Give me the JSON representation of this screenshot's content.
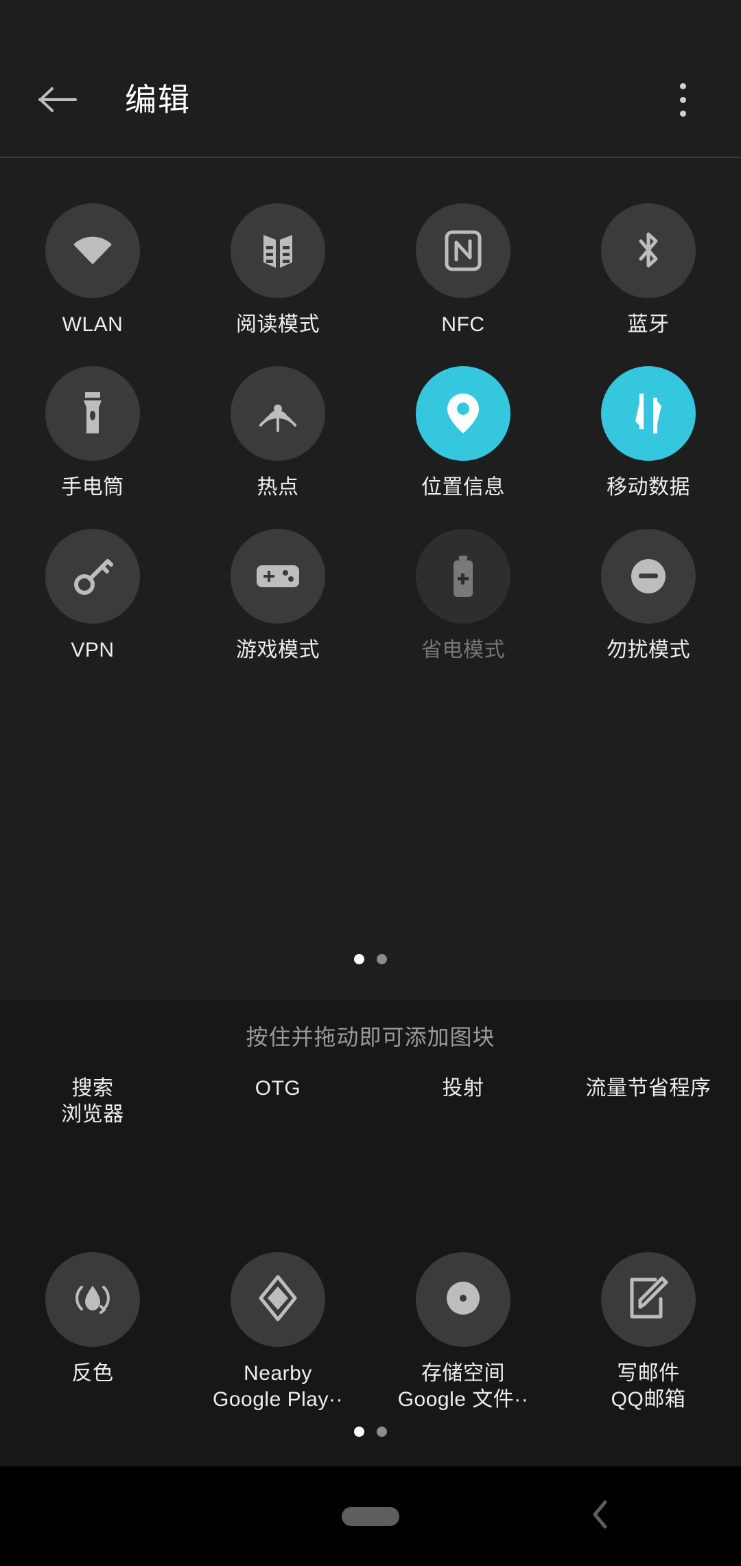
{
  "app_bar": {
    "title": "编辑",
    "back_icon": "arrow-left-icon",
    "overflow_icon": "more-vertical-icon"
  },
  "active_tiles": {
    "rows": [
      [
        {
          "label": "WLAN",
          "icon": "wifi-icon",
          "state": "off"
        },
        {
          "label": "阅读模式",
          "icon": "book-icon",
          "state": "off"
        },
        {
          "label": "NFC",
          "icon": "nfc-icon",
          "state": "off"
        },
        {
          "label": "蓝牙",
          "icon": "bluetooth-icon",
          "state": "off"
        }
      ],
      [
        {
          "label": "手电筒",
          "icon": "flashlight-icon",
          "state": "off"
        },
        {
          "label": "热点",
          "icon": "hotspot-icon",
          "state": "off"
        },
        {
          "label": "位置信息",
          "icon": "location-pin-icon",
          "state": "on"
        },
        {
          "label": "移动数据",
          "icon": "mobile-data-icon",
          "state": "on"
        }
      ],
      [
        {
          "label": "VPN",
          "icon": "key-icon",
          "state": "off"
        },
        {
          "label": "游戏模式",
          "icon": "gamepad-icon",
          "state": "off"
        },
        {
          "label": "省电模式",
          "icon": "battery-saver-icon",
          "state": "disabled"
        },
        {
          "label": "勿扰模式",
          "icon": "do-not-disturb-icon",
          "state": "off"
        }
      ]
    ],
    "pager": {
      "count": 2,
      "active_index": 0
    }
  },
  "available_section": {
    "hint": "按住并拖动即可添加图块",
    "rows": [
      [
        {
          "label": "搜索",
          "sublabel": "浏览器",
          "icon": "",
          "has_icon": false
        },
        {
          "label": "OTG",
          "sublabel": "",
          "icon": "",
          "has_icon": false
        },
        {
          "label": "投射",
          "sublabel": "",
          "icon": "",
          "has_icon": false
        },
        {
          "label": "流量节省程序",
          "sublabel": "",
          "icon": "",
          "has_icon": false
        }
      ],
      [
        {
          "label": "反色",
          "sublabel": "",
          "icon": "invert-colors-icon",
          "has_icon": true
        },
        {
          "label": "Nearby",
          "sublabel": "Google Play··",
          "icon": "nearby-share-icon",
          "has_icon": true
        },
        {
          "label": "存储空间",
          "sublabel": "Google 文件··",
          "icon": "storage-disc-icon",
          "has_icon": true
        },
        {
          "label": "写邮件",
          "sublabel": "QQ邮箱",
          "icon": "compose-mail-icon",
          "has_icon": true
        }
      ]
    ],
    "pager": {
      "count": 2,
      "active_index": 0
    }
  },
  "nav_bar": {
    "home_pill": "home-gesture-pill",
    "back_icon": "chevron-left-icon"
  },
  "colors": {
    "accent_on": "#35C7DD",
    "pane_bg": "#1E1E1E",
    "avail_bg": "#171717",
    "tile_circle": "#3B3B3B",
    "label": "#EEEEEE",
    "hint": "#9A9A9A",
    "disabled_label": "#757575",
    "nav_bg": "#000000"
  }
}
